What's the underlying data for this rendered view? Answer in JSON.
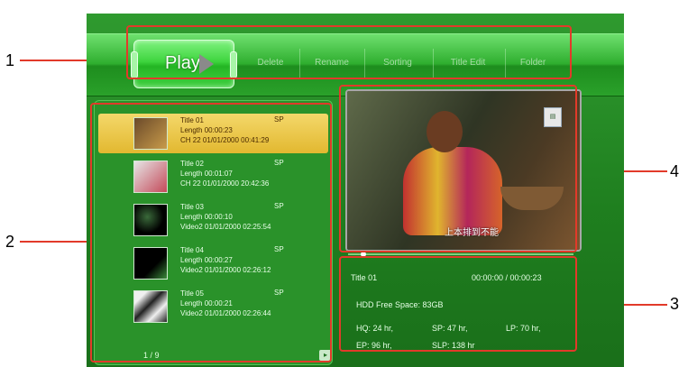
{
  "menu": {
    "play_label": "Play",
    "items": [
      "Delete",
      "Rename",
      "Sorting",
      "Title Edit",
      "Folder"
    ]
  },
  "titles": [
    {
      "title": "Title 01",
      "mode": "SP",
      "length": "Length  00:00:23",
      "info": "CH 22 01/01/2000 00:41:29"
    },
    {
      "title": "Title 02",
      "mode": "SP",
      "length": "Length  00:01:07",
      "info": "CH 22 01/01/2000 20:42:36"
    },
    {
      "title": "Title 03",
      "mode": "SP",
      "length": "Length  00:00:10",
      "info": "Video2 01/01/2000 02:25:54"
    },
    {
      "title": "Title 04",
      "mode": "SP",
      "length": "Length  00:00:27",
      "info": "Video2 01/01/2000 02:26:12"
    },
    {
      "title": "Title 05",
      "mode": "SP",
      "length": "Length  00:00:21",
      "info": "Video2 01/01/2000 02:26:44"
    }
  ],
  "page_indicator": "1 / 9",
  "preview": {
    "subtitle": "上本排到不能"
  },
  "info": {
    "title": "Title  01",
    "time": "00:00:00 / 00:00:23",
    "hdd_free": "HDD Free Space: 83GB",
    "hq": "HQ: 24 hr,",
    "sp": "SP: 47 hr,",
    "lp": "LP: 70 hr,",
    "ep": "EP: 96 hr,",
    "slp": "SLP: 138 hr"
  },
  "callouts": [
    "1",
    "2",
    "3",
    "4"
  ],
  "colors": {
    "highlight": "#f4d86a",
    "panel": "#2a922a",
    "callout": "#e23a2a"
  }
}
